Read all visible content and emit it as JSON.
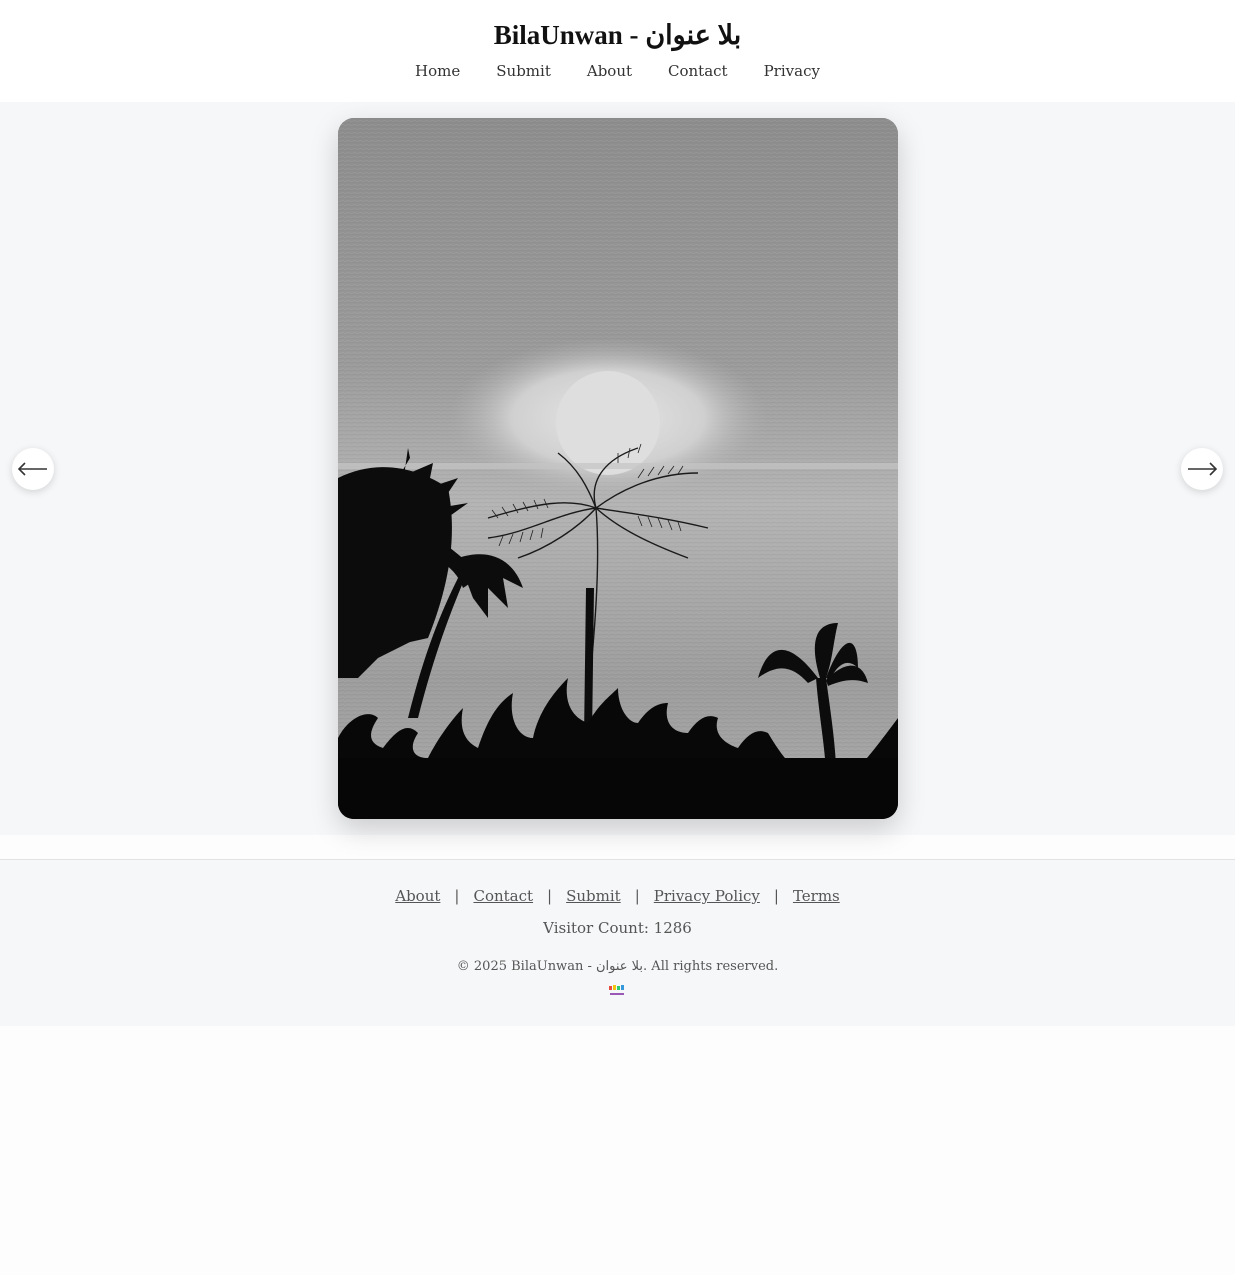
{
  "site": {
    "title": "BilaUnwan - بلا عنوان"
  },
  "nav": {
    "items": [
      {
        "label": "Home"
      },
      {
        "label": "Submit"
      },
      {
        "label": "About"
      },
      {
        "label": "Contact"
      },
      {
        "label": "Privacy"
      }
    ]
  },
  "carousel": {
    "prev_icon": "arrow-left-icon",
    "next_icon": "arrow-right-icon",
    "artwork_description_icon": "pencil-sketch-artwork"
  },
  "footer": {
    "links": [
      {
        "label": "About"
      },
      {
        "label": "Contact"
      },
      {
        "label": "Submit"
      },
      {
        "label": "Privacy Policy"
      },
      {
        "label": "Terms"
      }
    ],
    "separator": "|",
    "visitor_count": "Visitor Count: 1286",
    "copyright": "© 2025 BilaUnwan - بلا عنوان. All rights reserved."
  },
  "colors": {
    "page_bg": "#fdfdfd",
    "stage_bg": "#f6f7f9",
    "text": "#222222",
    "muted": "#555555"
  }
}
